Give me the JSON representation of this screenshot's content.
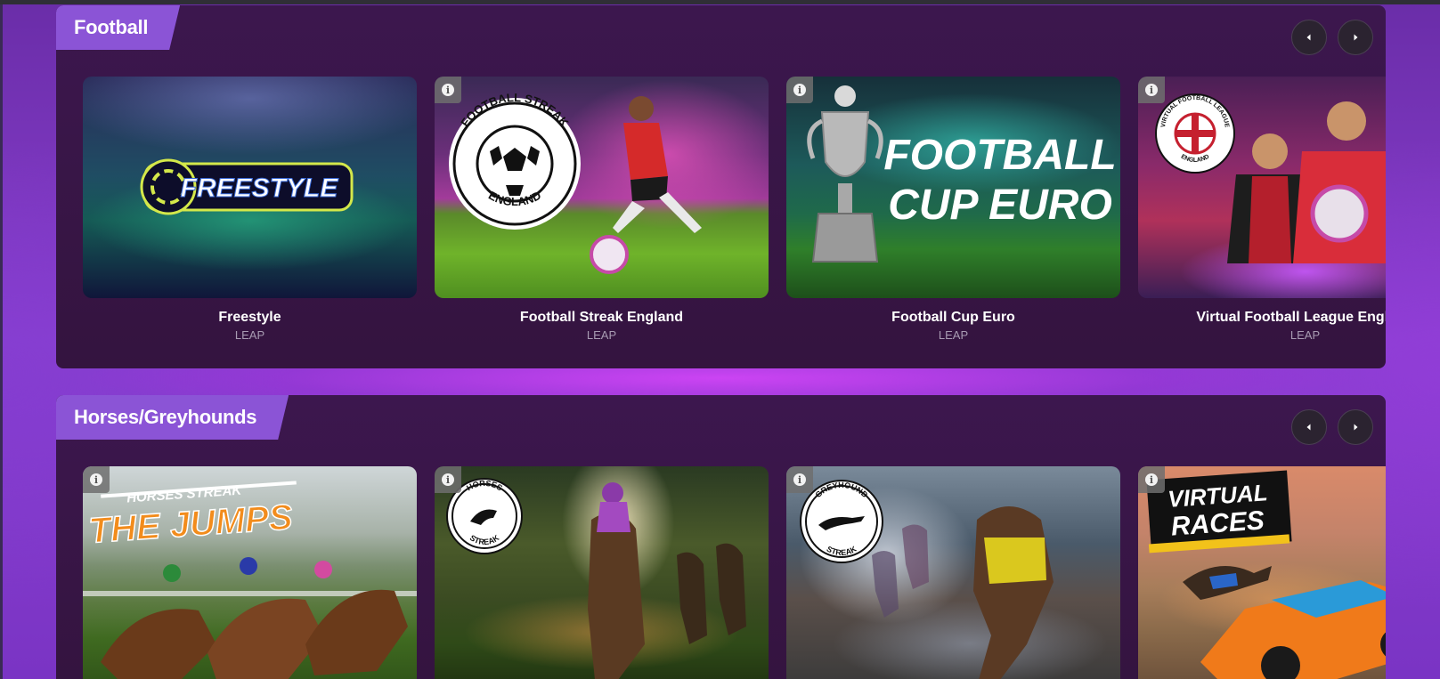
{
  "sections": [
    {
      "title": "Football",
      "games": [
        {
          "title": "Freestyle",
          "provider": "LEAP",
          "logo_text": "FREESTYLE"
        },
        {
          "title": "Football Streak England",
          "provider": "LEAP",
          "logo_top": "FOOTBALL STREAK",
          "logo_bottom": "ENGLAND"
        },
        {
          "title": "Football Cup Euro",
          "provider": "LEAP",
          "logo_line1": "FOOTBALL",
          "logo_line2": "CUP EURO"
        },
        {
          "title": "Virtual Football League England",
          "provider": "LEAP",
          "logo_top": "VIRTUAL FOOTBALL LEAGUE",
          "logo_bottom": "ENGLAND"
        }
      ]
    },
    {
      "title": "Horses/Greyhounds",
      "games": [
        {
          "title": "",
          "provider": "",
          "logo_top": "HORSES STREAK",
          "logo_main": "THE JUMPS"
        },
        {
          "title": "",
          "provider": "",
          "logo_top": "HORSES",
          "logo_bottom": "STREAK"
        },
        {
          "title": "",
          "provider": "",
          "logo_top": "GREYHOUND",
          "logo_bottom": "STREAK"
        },
        {
          "title": "",
          "provider": "",
          "logo_line1": "VIRTUAL",
          "logo_line2": "RACES"
        }
      ]
    }
  ],
  "icons": {
    "prev": "chevron-left-icon",
    "next": "chevron-right-icon",
    "info": "info-icon"
  },
  "colors": {
    "tab": "#8b54d6",
    "panel": "#3c174e",
    "background": "#8a3fd0"
  }
}
